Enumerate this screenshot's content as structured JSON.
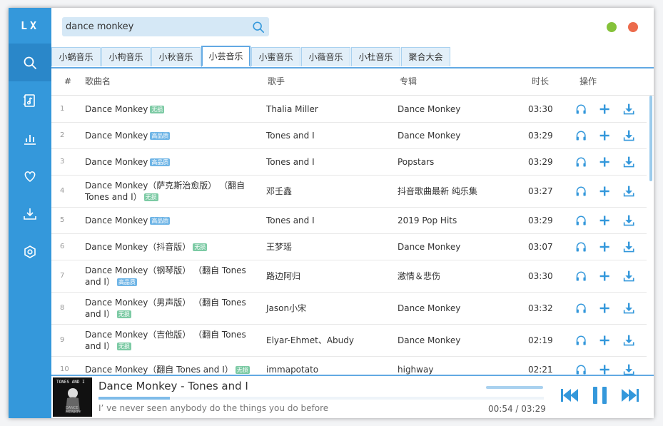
{
  "app": {
    "logo": "LX"
  },
  "search": {
    "value": "dance monkey",
    "placeholder": ""
  },
  "sidebar": {
    "items": [
      {
        "name": "search-icon",
        "active": true
      },
      {
        "name": "music-list-icon",
        "active": false
      },
      {
        "name": "chart-icon",
        "active": false
      },
      {
        "name": "heart-icon",
        "active": false
      },
      {
        "name": "download-icon",
        "active": false
      },
      {
        "name": "settings-icon",
        "active": false
      }
    ]
  },
  "tabs": [
    {
      "label": "小蜗音乐"
    },
    {
      "label": "小枸音乐"
    },
    {
      "label": "小秋音乐"
    },
    {
      "label": "小芸音乐",
      "active": true
    },
    {
      "label": "小蜜音乐"
    },
    {
      "label": "小薇音乐"
    },
    {
      "label": "小杜音乐"
    },
    {
      "label": "聚合大会"
    }
  ],
  "table": {
    "headers": {
      "num": "#",
      "name": "歌曲名",
      "artist": "歌手",
      "album": "专辑",
      "duration": "时长",
      "ops": "操作"
    },
    "rows": [
      {
        "num": "1",
        "name": "Dance Monkey",
        "badge": "无损",
        "badge_color": "green",
        "artist": "Thalia Miller",
        "album": "Dance Monkey",
        "duration": "03:30"
      },
      {
        "num": "2",
        "name": "Dance Monkey",
        "badge": "高品质",
        "badge_color": "blue",
        "artist": "Tones and I",
        "album": "Dance Monkey",
        "duration": "03:29"
      },
      {
        "num": "3",
        "name": "Dance Monkey",
        "badge": "高品质",
        "badge_color": "blue",
        "artist": "Tones and I",
        "album": "Popstars",
        "duration": "03:29"
      },
      {
        "num": "4",
        "name": "Dance Monkey（萨克斯治愈版） （翻自 Tones and I）",
        "badge": "无损",
        "badge_color": "green",
        "artist": "邓壬鑫",
        "album": "抖音歌曲最新 纯乐集",
        "duration": "03:27"
      },
      {
        "num": "5",
        "name": "Dance Monkey",
        "badge": "高品质",
        "badge_color": "blue",
        "artist": "Tones and I",
        "album": "2019 Pop Hits",
        "duration": "03:29"
      },
      {
        "num": "6",
        "name": "Dance Monkey（抖音版）",
        "badge": "无损",
        "badge_color": "green",
        "artist": "王梦瑶",
        "album": "Dance Monkey",
        "duration": "03:07"
      },
      {
        "num": "7",
        "name": "Dance Monkey（钢琴版） （翻自 Tones and I）",
        "badge": "高品质",
        "badge_color": "blue",
        "artist": "路边阿归",
        "album": "激情＆悲伤",
        "duration": "03:30"
      },
      {
        "num": "8",
        "name": "Dance Monkey（男声版） （翻自 Tones and I）",
        "badge": "无损",
        "badge_color": "green",
        "artist": "Jason小宋",
        "album": "Dance Monkey",
        "duration": "03:32"
      },
      {
        "num": "9",
        "name": "Dance Monkey（吉他版） （翻自 Tones and I）",
        "badge": "无损",
        "badge_color": "green",
        "artist": "Elyar-Ehmet、Abudy",
        "album": "Dance Monkey",
        "duration": "02:19"
      },
      {
        "num": "10",
        "name": "Dance Monkey（翻自 Tones and I）",
        "badge": "无损",
        "badge_color": "green",
        "artist": "immapotato",
        "album": "highway",
        "duration": "02:21"
      }
    ]
  },
  "player": {
    "cover_title": "TONES AND I",
    "cover_subtitle": "DANCE MONKEY",
    "title": "Dance Monkey - Tones and I",
    "lyric": "I’ ve never seen anybody do the things you do before",
    "time": "00:54 / 03:29",
    "progress": 0.259
  },
  "colors": {
    "accent": "#3498db",
    "minimize": "#85c23a",
    "close": "#ec6b4c"
  }
}
